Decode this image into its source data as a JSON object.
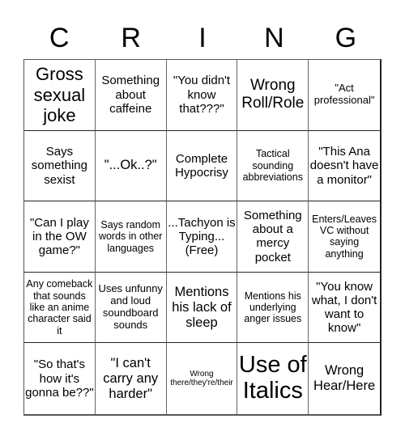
{
  "header": {
    "letters": [
      "C",
      "R",
      "I",
      "N",
      "G"
    ]
  },
  "board": {
    "cells": [
      "Gross sexual joke",
      "Something about caffeine",
      "\"You didn't know that???\"",
      "Wrong Roll/Role",
      "\"Act professional\"",
      "Says something sexist",
      "\"...Ok..?\"",
      "Complete Hypocrisy",
      "Tactical sounding abbreviations",
      "\"This Ana doesn't have a monitor\"",
      "\"Can I play in the OW game?\"",
      "Says random words in other languages",
      "...Tachyon is Typing... (Free)",
      "Something about a mercy pocket",
      "Enters/Leaves VC without saying anything",
      "Any comeback that sounds like an anime character said it",
      "Uses unfunny and loud soundboard sounds",
      "Mentions his lack of sleep",
      "Mentions his underlying anger issues",
      "\"You know what, I don't want to know\"",
      "\"So that's how it's gonna be??\"",
      "\"I can't carry any harder\"",
      "Wrong there/they're/their",
      "Use of Italics",
      "Wrong Hear/Here"
    ],
    "free_space": "...Tachyon is Typing... (Free)"
  }
}
